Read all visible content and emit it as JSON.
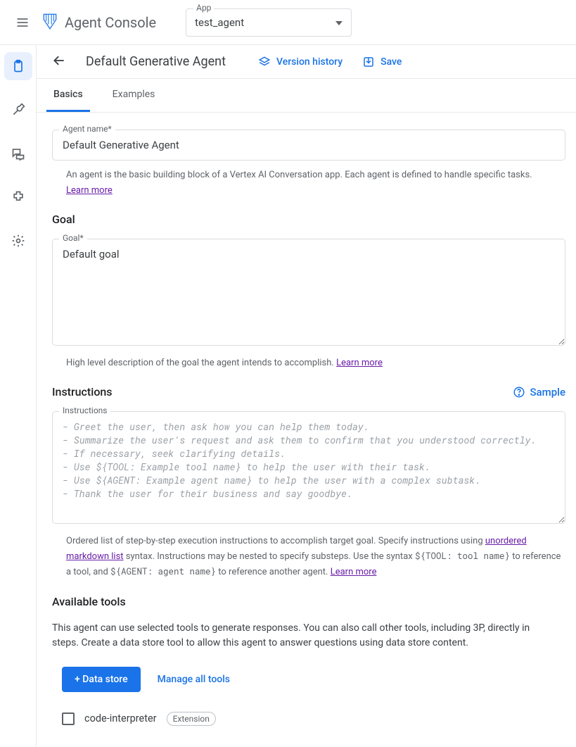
{
  "header": {
    "productName": "Agent Console",
    "appLabel": "App",
    "appSelected": "test_agent"
  },
  "sidebar": {
    "items": [
      {
        "name": "agents-icon"
      },
      {
        "name": "tools-icon"
      },
      {
        "name": "conversations-icon"
      },
      {
        "name": "integrations-icon"
      },
      {
        "name": "settings-icon"
      }
    ]
  },
  "page": {
    "title": "Default Generative Agent",
    "actions": {
      "versionHistory": "Version history",
      "save": "Save"
    },
    "tabs": [
      "Basics",
      "Examples"
    ],
    "activeTab": 0
  },
  "form": {
    "agentName": {
      "label": "Agent name*",
      "value": "Default Generative Agent",
      "helper": "An agent is the basic building block of a Vertex AI Conversation app. Each agent is defined to handle specific tasks.",
      "learnMore": "Learn more"
    },
    "goal": {
      "sectionTitle": "Goal",
      "label": "Goal*",
      "value": "Default goal",
      "helper": "High level description of the goal the agent intends to accomplish.",
      "learnMore": "Learn more"
    },
    "instructions": {
      "sectionTitle": "Instructions",
      "sampleLabel": "Sample",
      "label": "Instructions",
      "placeholder": "- Greet the user, then ask how you can help them today.\n- Summarize the user's request and ask them to confirm that you understood correctly.\n- If necessary, seek clarifying details.\n- Use ${TOOL: Example tool name} to help the user with their task.\n- Use ${AGENT: Example agent name} to help the user with a complex subtask.\n- Thank the user for their business and say goodbye.",
      "helperPre": "Ordered list of step-by-step execution instructions to accomplish target goal. Specify instructions using ",
      "helperLink1": "unordered markdown list",
      "helperMid1": " syntax. Instructions may be nested to specify substeps. Use the syntax ",
      "helperMono1": "${TOOL: tool name}",
      "helperMid2": " to reference a tool, and ",
      "helperMono2": "${AGENT: agent name}",
      "helperMid3": " to reference another agent. ",
      "learnMore": "Learn more"
    },
    "tools": {
      "sectionTitle": "Available tools",
      "description": "This agent can use selected tools to generate responses. You can also call other tools, including 3P, directly in steps. Create a data store tool to allow this agent to answer questions using data store content.",
      "dataStoreBtn": "+ Data store",
      "manageAllBtn": "Manage all tools",
      "items": [
        {
          "name": "code-interpreter",
          "chip": "Extension",
          "checked": false
        }
      ]
    }
  }
}
